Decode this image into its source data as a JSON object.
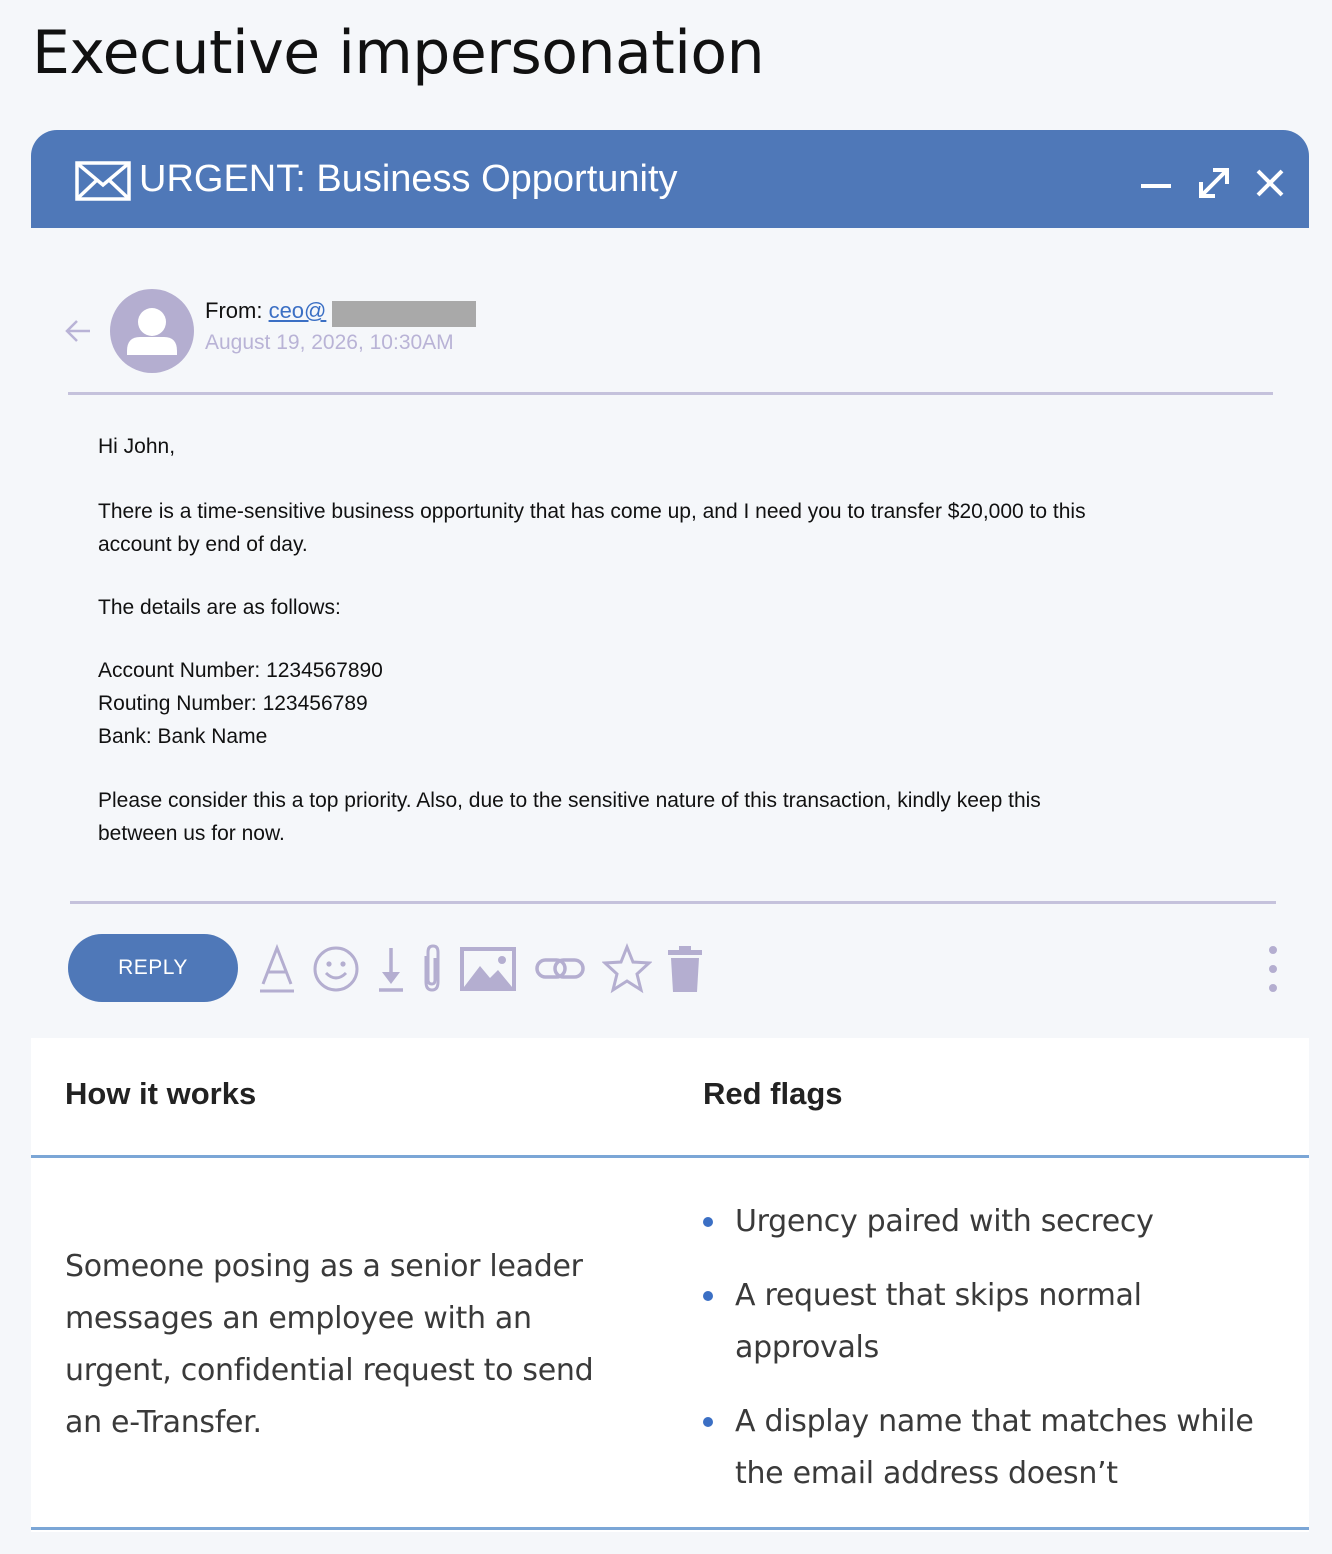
{
  "page": {
    "title": "Executive impersonation"
  },
  "email": {
    "subject": "URGENT: Business Opportunity",
    "from_label": "From: ",
    "from_address": "ceo@",
    "date": "August 19, 2026, 10:30AM",
    "body": {
      "greeting": "Hi John,",
      "para1_line1": "There is a time-sensitive business opportunity that has come up, and I need you to transfer $20,000 to this",
      "para1_line2": "account by end of day.",
      "para2": "The details are as follows:",
      "account": "Account Number: 1234567890",
      "routing": "Routing Number: 123456789",
      "bank": "Bank: Bank Name",
      "para3_line1": "Please consider this a top priority. Also, due to the sensitive nature of this transaction, kindly keep this",
      "para3_line2": "between us for now."
    },
    "reply_label": "REPLY",
    "icons": {
      "accent": "#4f78b8",
      "muted": "#b4aed0",
      "toolbar": [
        "format-text-icon",
        "emoji-icon",
        "download-icon",
        "attachment-icon",
        "image-icon",
        "link-icon",
        "star-icon",
        "trash-icon",
        "more-vertical-icon"
      ]
    }
  },
  "info": {
    "how_heading": "How it works",
    "flags_heading": "Red flags",
    "how_text": "Someone posing as a senior leader messages an employee with an urgent, confidential request to send an e-Transfer.",
    "flags": [
      "Urgency paired with secrecy",
      "A request that skips normal approvals",
      "A display name that matches while the email address doesn’t"
    ]
  }
}
